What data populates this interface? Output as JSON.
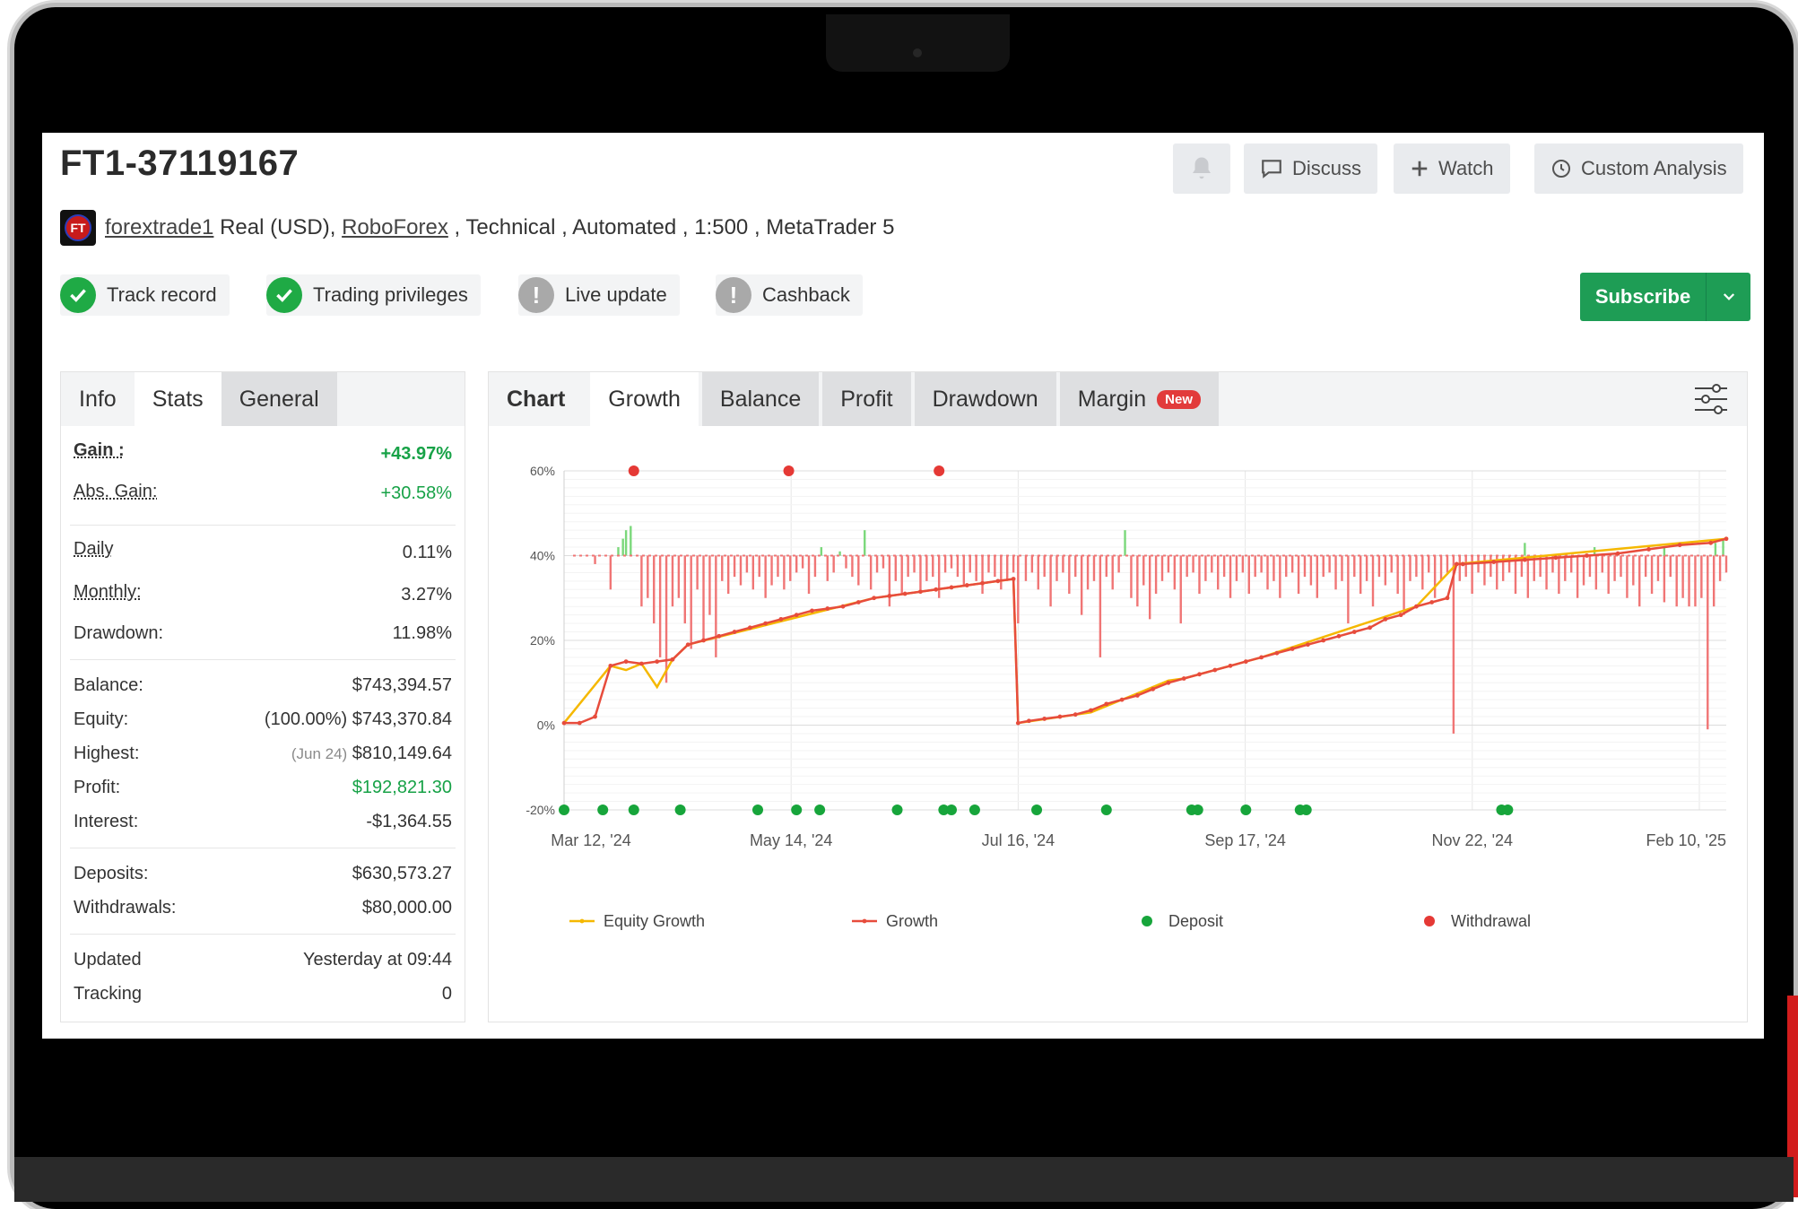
{
  "account": {
    "title": "FT1-37119167",
    "avatar_text": "FT",
    "username": "forextrade1",
    "meta_a": " Real (USD), ",
    "broker": "RoboForex",
    "meta_b": " , Technical , Automated , 1:500 , MetaTrader 5"
  },
  "header_buttons": {
    "discuss": "Discuss",
    "watch": "Watch",
    "custom_analysis": "Custom Analysis"
  },
  "badges": {
    "track_record": "Track record",
    "trading_privileges": "Trading privileges",
    "live_update": "Live update",
    "cashback": "Cashback",
    "warn_glyph": "!"
  },
  "subscribe": "Subscribe",
  "stats_tabs": [
    "Info",
    "Stats",
    "General"
  ],
  "stats": {
    "gain": {
      "label": "Gain :",
      "value": "+43.97%"
    },
    "abs_gain": {
      "label": "Abs. Gain:",
      "value": "+30.58%"
    },
    "daily": {
      "label": "Daily",
      "value": "0.11%"
    },
    "monthly": {
      "label": "Monthly:",
      "value": "3.27%"
    },
    "drawdown": {
      "label": "Drawdown:",
      "value": "11.98%"
    },
    "balance": {
      "label": "Balance:",
      "value": "$743,394.57"
    },
    "equity": {
      "label": "Equity:",
      "pct": "(100.00%)",
      "value": "$743,370.84"
    },
    "highest": {
      "label": "Highest:",
      "date": "(Jun 24)",
      "value": "$810,149.64"
    },
    "profit": {
      "label": "Profit:",
      "value": "$192,821.30"
    },
    "interest": {
      "label": "Interest:",
      "value": "-$1,364.55"
    },
    "deposits": {
      "label": "Deposits:",
      "value": "$630,573.27"
    },
    "withdrawals": {
      "label": "Withdrawals:",
      "value": "$80,000.00"
    },
    "updated": {
      "label": "Updated",
      "value": "Yesterday at 09:44"
    },
    "tracking": {
      "label": "Tracking",
      "value": "0"
    }
  },
  "chart_tabs": {
    "label": "Chart",
    "tabs": [
      "Growth",
      "Balance",
      "Profit",
      "Drawdown",
      "Margin"
    ],
    "new_badge": "New"
  },
  "colors": {
    "growth": "#e74c3c",
    "equity": "#f5b800",
    "deposit": "#17a53b",
    "withdrawal": "#e53935",
    "bar_neg": "#f07575",
    "bar_pos": "#7bd87b",
    "brand_green": "#1e9d55"
  },
  "chart_data": {
    "type": "line",
    "ylim": [
      -20,
      60
    ],
    "y_ticks": [
      "60%",
      "40%",
      "20%",
      "0%",
      "-20%"
    ],
    "y_tick_values": [
      60,
      40,
      20,
      0,
      -20
    ],
    "x_ticks": [
      "Mar 12, '24",
      "May 14, '24",
      "Jul 16, '24",
      "Sep 17, '24",
      "Nov 22, '24",
      "Feb 10, '25"
    ],
    "legend": [
      "Equity Growth",
      "Growth",
      "Deposit",
      "Withdrawal"
    ],
    "series": [
      {
        "name": "Growth",
        "points": [
          [
            0,
            0.5
          ],
          [
            1,
            0.5
          ],
          [
            2,
            2
          ],
          [
            3,
            14
          ],
          [
            4,
            15
          ],
          [
            5,
            14.5
          ],
          [
            6,
            15
          ],
          [
            7,
            15.5
          ],
          [
            8,
            19
          ],
          [
            9,
            20
          ],
          [
            10,
            21
          ],
          [
            11,
            22
          ],
          [
            12,
            23
          ],
          [
            13,
            24
          ],
          [
            14,
            25
          ],
          [
            15,
            26
          ],
          [
            16,
            27
          ],
          [
            17,
            27.5
          ],
          [
            18,
            28
          ],
          [
            19,
            29
          ],
          [
            20,
            30
          ],
          [
            21,
            30.5
          ],
          [
            22,
            31
          ],
          [
            23,
            31.5
          ],
          [
            24,
            32
          ],
          [
            25,
            32.5
          ],
          [
            26,
            33
          ],
          [
            27,
            33.5
          ],
          [
            28,
            34
          ],
          [
            29,
            34.5
          ],
          [
            29.3,
            0.5
          ],
          [
            30,
            1
          ],
          [
            31,
            1.5
          ],
          [
            32,
            2
          ],
          [
            33,
            2.5
          ],
          [
            34,
            3.5
          ],
          [
            35,
            5
          ],
          [
            36,
            6
          ],
          [
            37,
            7
          ],
          [
            38,
            8.5
          ],
          [
            39,
            10
          ],
          [
            40,
            11
          ],
          [
            41,
            12
          ],
          [
            42,
            13
          ],
          [
            43,
            14
          ],
          [
            44,
            15
          ],
          [
            45,
            16
          ],
          [
            46,
            17
          ],
          [
            47,
            18
          ],
          [
            48,
            19
          ],
          [
            49,
            20
          ],
          [
            50,
            21
          ],
          [
            51,
            22
          ],
          [
            52,
            23
          ],
          [
            53,
            25
          ],
          [
            54,
            26
          ],
          [
            55,
            28
          ],
          [
            56,
            29
          ],
          [
            57,
            30
          ],
          [
            57.6,
            38
          ],
          [
            58,
            38
          ],
          [
            60,
            38.5
          ],
          [
            62,
            39
          ],
          [
            64,
            39.5
          ],
          [
            66,
            40
          ],
          [
            68,
            40.5
          ],
          [
            70,
            41.5
          ],
          [
            72,
            42.5
          ],
          [
            74,
            43
          ],
          [
            75,
            43.97
          ]
        ]
      },
      {
        "name": "Equity Growth",
        "points": [
          [
            0,
            0.5
          ],
          [
            3,
            14
          ],
          [
            4,
            13
          ],
          [
            5,
            14.5
          ],
          [
            6,
            9
          ],
          [
            7,
            15.5
          ],
          [
            8,
            19
          ],
          [
            20,
            30
          ],
          [
            29,
            34.5
          ],
          [
            29.3,
            0.5
          ],
          [
            34,
            3
          ],
          [
            35,
            4.5
          ],
          [
            36,
            6
          ],
          [
            37,
            7.5
          ],
          [
            38,
            9
          ],
          [
            39,
            10.5
          ],
          [
            40,
            11
          ],
          [
            45,
            16
          ],
          [
            55,
            28
          ],
          [
            57.6,
            38
          ],
          [
            75,
            43.97
          ]
        ]
      }
    ],
    "bars": [
      {
        "x": 2,
        "v": -2
      },
      {
        "x": 3,
        "v": -8
      },
      {
        "x": 3.5,
        "v": 2
      },
      {
        "x": 3.8,
        "v": 4
      },
      {
        "x": 4,
        "v": 6
      },
      {
        "x": 4.3,
        "v": 7
      },
      {
        "x": 5,
        "v": -12
      },
      {
        "x": 5.4,
        "v": -10
      },
      {
        "x": 5.8,
        "v": -16
      },
      {
        "x": 6.2,
        "v": -24
      },
      {
        "x": 6.6,
        "v": -30
      },
      {
        "x": 7,
        "v": -12
      },
      {
        "x": 7.4,
        "v": -10
      },
      {
        "x": 7.8,
        "v": -16
      },
      {
        "x": 8.2,
        "v": -22
      },
      {
        "x": 8.6,
        "v": -8
      },
      {
        "x": 9,
        "v": -20
      },
      {
        "x": 9.4,
        "v": -14
      },
      {
        "x": 9.8,
        "v": -24
      },
      {
        "x": 10.2,
        "v": -6
      },
      {
        "x": 10.6,
        "v": -9
      },
      {
        "x": 11,
        "v": -5
      },
      {
        "x": 11.4,
        "v": -7
      },
      {
        "x": 11.8,
        "v": -4
      },
      {
        "x": 12.2,
        "v": -8
      },
      {
        "x": 12.6,
        "v": -5
      },
      {
        "x": 13,
        "v": -10
      },
      {
        "x": 13.4,
        "v": -7
      },
      {
        "x": 13.8,
        "v": -5
      },
      {
        "x": 14.2,
        "v": -8
      },
      {
        "x": 14.6,
        "v": -6
      },
      {
        "x": 15,
        "v": -4
      },
      {
        "x": 15.4,
        "v": -3
      },
      {
        "x": 15.8,
        "v": -9
      },
      {
        "x": 16.2,
        "v": -5
      },
      {
        "x": 16.6,
        "v": 2
      },
      {
        "x": 17,
        "v": -6
      },
      {
        "x": 17.4,
        "v": -4
      },
      {
        "x": 17.8,
        "v": 1
      },
      {
        "x": 18.2,
        "v": -3
      },
      {
        "x": 18.6,
        "v": -5
      },
      {
        "x": 19,
        "v": -7
      },
      {
        "x": 19.4,
        "v": 6
      },
      {
        "x": 19.8,
        "v": -8
      },
      {
        "x": 20.2,
        "v": -4
      },
      {
        "x": 20.6,
        "v": -3
      },
      {
        "x": 21,
        "v": -12
      },
      {
        "x": 21.4,
        "v": -6
      },
      {
        "x": 21.8,
        "v": -9
      },
      {
        "x": 22.2,
        "v": -5
      },
      {
        "x": 22.6,
        "v": -4
      },
      {
        "x": 23,
        "v": -8
      },
      {
        "x": 23.4,
        "v": -6
      },
      {
        "x": 23.8,
        "v": -5
      },
      {
        "x": 24.2,
        "v": -10
      },
      {
        "x": 24.6,
        "v": -4
      },
      {
        "x": 25,
        "v": -3
      },
      {
        "x": 25.4,
        "v": -5
      },
      {
        "x": 25.8,
        "v": -7
      },
      {
        "x": 26.2,
        "v": -4
      },
      {
        "x": 26.6,
        "v": -6
      },
      {
        "x": 27,
        "v": -9
      },
      {
        "x": 27.4,
        "v": -4
      },
      {
        "x": 27.8,
        "v": -5
      },
      {
        "x": 28.2,
        "v": -8
      },
      {
        "x": 28.6,
        "v": -6
      },
      {
        "x": 29,
        "v": -4
      },
      {
        "x": 29.3,
        "v": -16
      },
      {
        "x": 29.8,
        "v": -6
      },
      {
        "x": 30.2,
        "v": -4
      },
      {
        "x": 30.6,
        "v": -8
      },
      {
        "x": 31,
        "v": -5
      },
      {
        "x": 31.4,
        "v": -12
      },
      {
        "x": 31.8,
        "v": -6
      },
      {
        "x": 32.2,
        "v": -4
      },
      {
        "x": 32.6,
        "v": -9
      },
      {
        "x": 33,
        "v": -5
      },
      {
        "x": 33.4,
        "v": -14
      },
      {
        "x": 33.8,
        "v": -8
      },
      {
        "x": 34.2,
        "v": -6
      },
      {
        "x": 34.6,
        "v": -24
      },
      {
        "x": 35,
        "v": -5
      },
      {
        "x": 35.4,
        "v": -8
      },
      {
        "x": 35.8,
        "v": -4
      },
      {
        "x": 36.2,
        "v": 6
      },
      {
        "x": 36.6,
        "v": -10
      },
      {
        "x": 37,
        "v": -12
      },
      {
        "x": 37.4,
        "v": -7
      },
      {
        "x": 37.8,
        "v": -15
      },
      {
        "x": 38.2,
        "v": -9
      },
      {
        "x": 38.6,
        "v": -6
      },
      {
        "x": 39,
        "v": -4
      },
      {
        "x": 39.4,
        "v": -8
      },
      {
        "x": 39.8,
        "v": -16
      },
      {
        "x": 40.2,
        "v": -5
      },
      {
        "x": 40.6,
        "v": -4
      },
      {
        "x": 41,
        "v": -9
      },
      {
        "x": 41.4,
        "v": -6
      },
      {
        "x": 41.8,
        "v": -4
      },
      {
        "x": 42.2,
        "v": -8
      },
      {
        "x": 42.6,
        "v": -5
      },
      {
        "x": 43,
        "v": -10
      },
      {
        "x": 43.4,
        "v": -6
      },
      {
        "x": 43.8,
        "v": -4
      },
      {
        "x": 44.2,
        "v": -9
      },
      {
        "x": 44.6,
        "v": -5
      },
      {
        "x": 45,
        "v": -4
      },
      {
        "x": 45.4,
        "v": -8
      },
      {
        "x": 45.8,
        "v": -6
      },
      {
        "x": 46.2,
        "v": -10
      },
      {
        "x": 46.6,
        "v": -5
      },
      {
        "x": 47,
        "v": -4
      },
      {
        "x": 47.4,
        "v": -9
      },
      {
        "x": 47.8,
        "v": -5
      },
      {
        "x": 48.2,
        "v": -7
      },
      {
        "x": 48.6,
        "v": -10
      },
      {
        "x": 49,
        "v": -5
      },
      {
        "x": 49.4,
        "v": -4
      },
      {
        "x": 49.8,
        "v": -8
      },
      {
        "x": 50.2,
        "v": -6
      },
      {
        "x": 50.6,
        "v": -16
      },
      {
        "x": 51,
        "v": -5
      },
      {
        "x": 51.4,
        "v": -9
      },
      {
        "x": 51.8,
        "v": -6
      },
      {
        "x": 52.2,
        "v": -12
      },
      {
        "x": 52.6,
        "v": -5
      },
      {
        "x": 53,
        "v": -7
      },
      {
        "x": 53.4,
        "v": -4
      },
      {
        "x": 53.8,
        "v": -9
      },
      {
        "x": 54.2,
        "v": -14
      },
      {
        "x": 54.6,
        "v": -6
      },
      {
        "x": 55,
        "v": -5
      },
      {
        "x": 55.4,
        "v": -8
      },
      {
        "x": 55.8,
        "v": -4
      },
      {
        "x": 56.2,
        "v": -10
      },
      {
        "x": 56.6,
        "v": -6
      },
      {
        "x": 57,
        "v": -4
      },
      {
        "x": 57.4,
        "v": -42
      },
      {
        "x": 57.8,
        "v": -6
      },
      {
        "x": 58.2,
        "v": -5
      },
      {
        "x": 58.6,
        "v": -9
      },
      {
        "x": 59,
        "v": -4
      },
      {
        "x": 59.4,
        "v": -7
      },
      {
        "x": 59.8,
        "v": -5
      },
      {
        "x": 60.2,
        "v": -8
      },
      {
        "x": 60.6,
        "v": -6
      },
      {
        "x": 61,
        "v": -4
      },
      {
        "x": 61.4,
        "v": -9
      },
      {
        "x": 61.8,
        "v": -5
      },
      {
        "x": 62.2,
        "v": -10
      },
      {
        "x": 62.6,
        "v": -6
      },
      {
        "x": 63,
        "v": -5
      },
      {
        "x": 63.4,
        "v": -8
      },
      {
        "x": 63.8,
        "v": -4
      },
      {
        "x": 64.2,
        "v": -9
      },
      {
        "x": 64.6,
        "v": -6
      },
      {
        "x": 65,
        "v": -4
      },
      {
        "x": 65.4,
        "v": -10
      },
      {
        "x": 65.8,
        "v": -7
      },
      {
        "x": 66.2,
        "v": -5
      },
      {
        "x": 66.6,
        "v": -8
      },
      {
        "x": 67,
        "v": -4
      },
      {
        "x": 67.4,
        "v": -9
      },
      {
        "x": 67.8,
        "v": -6
      },
      {
        "x": 68.2,
        "v": -5
      },
      {
        "x": 68.6,
        "v": -10
      },
      {
        "x": 69,
        "v": -7
      },
      {
        "x": 69.4,
        "v": -12
      },
      {
        "x": 69.8,
        "v": -5
      },
      {
        "x": 70.2,
        "v": -9
      },
      {
        "x": 70.6,
        "v": -6
      },
      {
        "x": 71,
        "v": -11
      },
      {
        "x": 71.4,
        "v": -5
      },
      {
        "x": 71.8,
        "v": -12
      },
      {
        "x": 72.2,
        "v": -10
      },
      {
        "x": 72.6,
        "v": -12
      },
      {
        "x": 73,
        "v": -12
      },
      {
        "x": 73.4,
        "v": -10
      },
      {
        "x": 73.8,
        "v": -41
      },
      {
        "x": 74.2,
        "v": -12
      },
      {
        "x": 74.6,
        "v": -6
      },
      {
        "x": 75,
        "v": -4
      },
      {
        "x": 62,
        "v": 3
      },
      {
        "x": 66.5,
        "v": 2
      },
      {
        "x": 71,
        "v": 2
      },
      {
        "x": 74.3,
        "v": 3
      },
      {
        "x": 74.8,
        "v": 4
      }
    ],
    "deposits": [
      0,
      2.5,
      4.5,
      7.5,
      12.5,
      15,
      16.5,
      21.5,
      24.5,
      25,
      26.5,
      30.5,
      35,
      40.5,
      40.9,
      44,
      47.5,
      47.9,
      60.5,
      60.9
    ],
    "withdrawals": [
      4.5,
      14.5,
      24.2
    ],
    "x_range": [
      0,
      75
    ]
  }
}
